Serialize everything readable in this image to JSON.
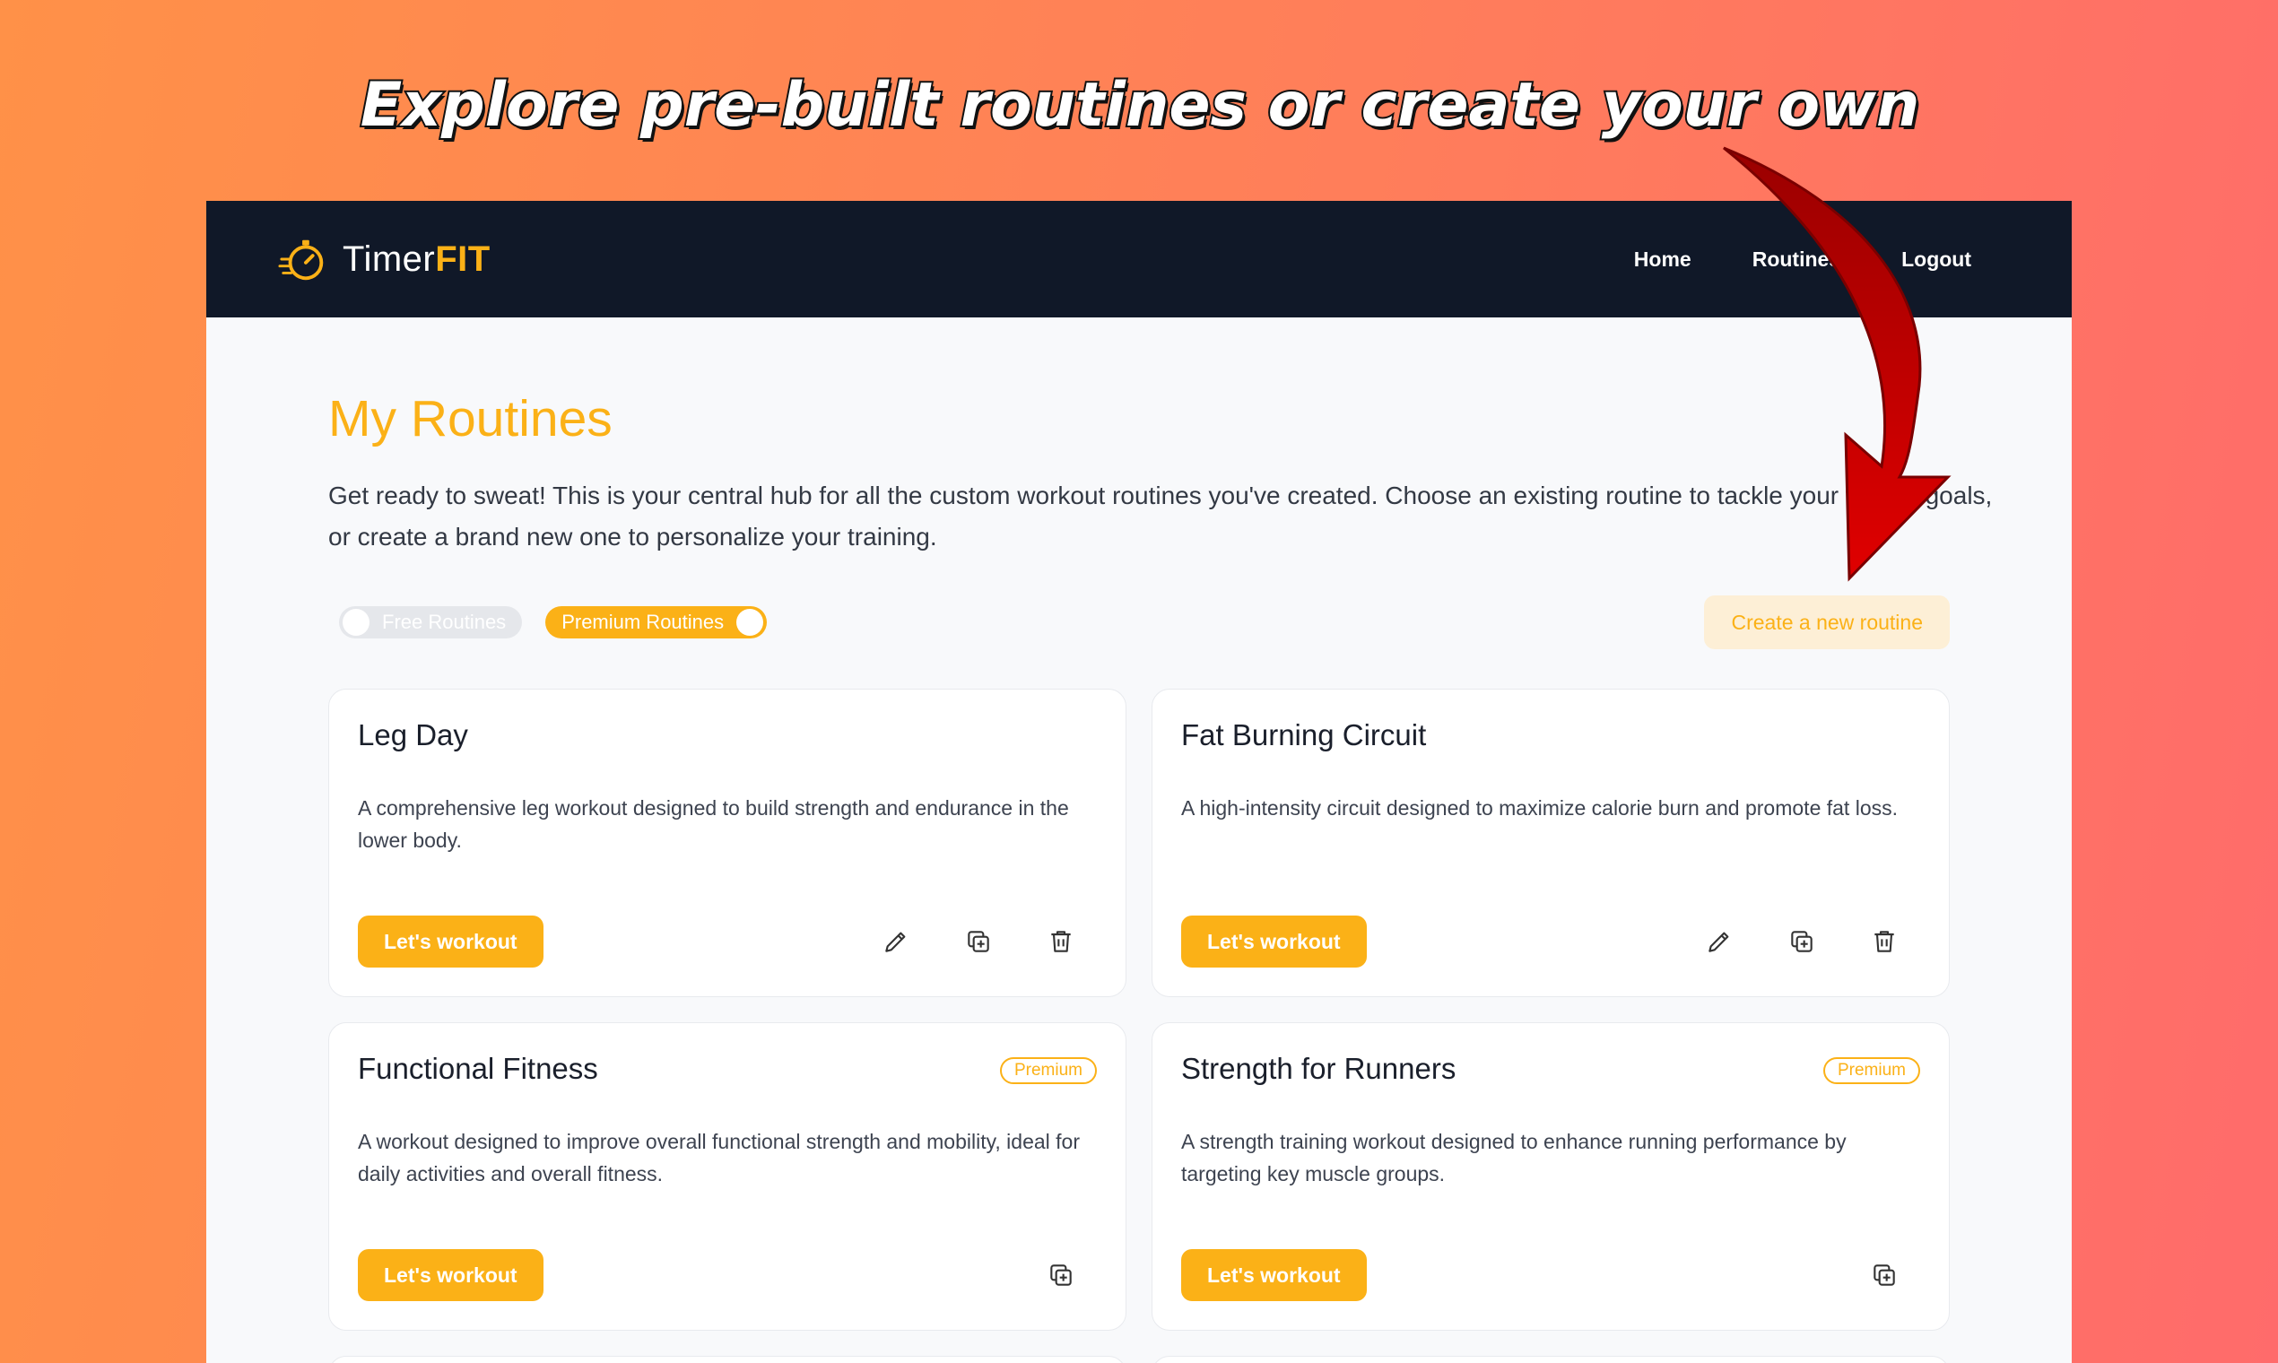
{
  "promo": {
    "headline": "Explore pre-built routines or create your own"
  },
  "navbar": {
    "brand_name": "Timer",
    "brand_accent": "FIT",
    "logo_icon": "stopwatch-runner-icon",
    "links": [
      "Home",
      "Routines",
      "Logout"
    ]
  },
  "page": {
    "title": "My Routines",
    "intro": "Get ready to sweat! This is your central hub for all the custom workout routines you've created. Choose an existing routine to tackle your fitness goals, or create a brand new one to personalize your training."
  },
  "filters": {
    "free_label": "Free Routines",
    "free_enabled": false,
    "premium_label": "Premium Routines",
    "premium_enabled": true
  },
  "create_button": "Create a new routine",
  "cards": [
    {
      "title": "Leg Day",
      "badge": "",
      "description": "A comprehensive leg workout designed to build strength and endurance in the lower body.",
      "button": "Let's workout",
      "actions": [
        "edit-icon",
        "duplicate-icon",
        "delete-icon"
      ]
    },
    {
      "title": "Fat Burning Circuit",
      "badge": "",
      "description": "A high-intensity circuit designed to maximize calorie burn and promote fat loss.",
      "button": "Let's workout",
      "actions": [
        "edit-icon",
        "duplicate-icon",
        "delete-icon"
      ]
    },
    {
      "title": "Functional Fitness",
      "badge": "Premium",
      "description": "A workout designed to improve overall functional strength and mobility, ideal for daily activities and overall fitness.",
      "button": "Let's workout",
      "actions": [
        "duplicate-icon"
      ]
    },
    {
      "title": "Strength for Runners",
      "badge": "Premium",
      "description": "A strength training workout designed to enhance running performance by targeting key muscle groups.",
      "button": "Let's workout",
      "actions": [
        "duplicate-icon"
      ]
    }
  ],
  "colors": {
    "accent": "#fbb117",
    "navbar_bg": "#101828",
    "arrow": "#d90000",
    "background_gradient": [
      "#ff9148",
      "#ff6b6b"
    ]
  }
}
